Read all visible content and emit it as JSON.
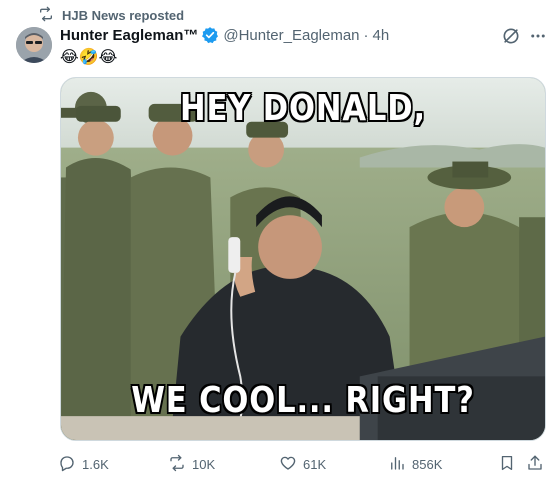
{
  "repost": {
    "label": "HJB News reposted",
    "icon": "repost-icon"
  },
  "tweet": {
    "display_name": "Hunter Eagleman™",
    "verified": true,
    "handle": "@Hunter_Eagleman",
    "separator": "·",
    "time": "4h",
    "text": "😂🤣😂"
  },
  "media": {
    "top_text": "HEY DONALD,",
    "bottom_text": "WE COOL... RIGHT?"
  },
  "actions": {
    "replies": "1.6K",
    "reposts": "10K",
    "likes": "61K",
    "views": "856K"
  },
  "colors": {
    "text_primary": "#0f1419",
    "text_secondary": "#536471",
    "verified_blue": "#1d9bf0",
    "border": "#cfd9de"
  },
  "icons": [
    "repost-icon",
    "verified-badge-icon",
    "grok-icon",
    "more-icon",
    "reply-icon",
    "like-icon",
    "views-icon",
    "bookmark-icon",
    "share-icon"
  ]
}
